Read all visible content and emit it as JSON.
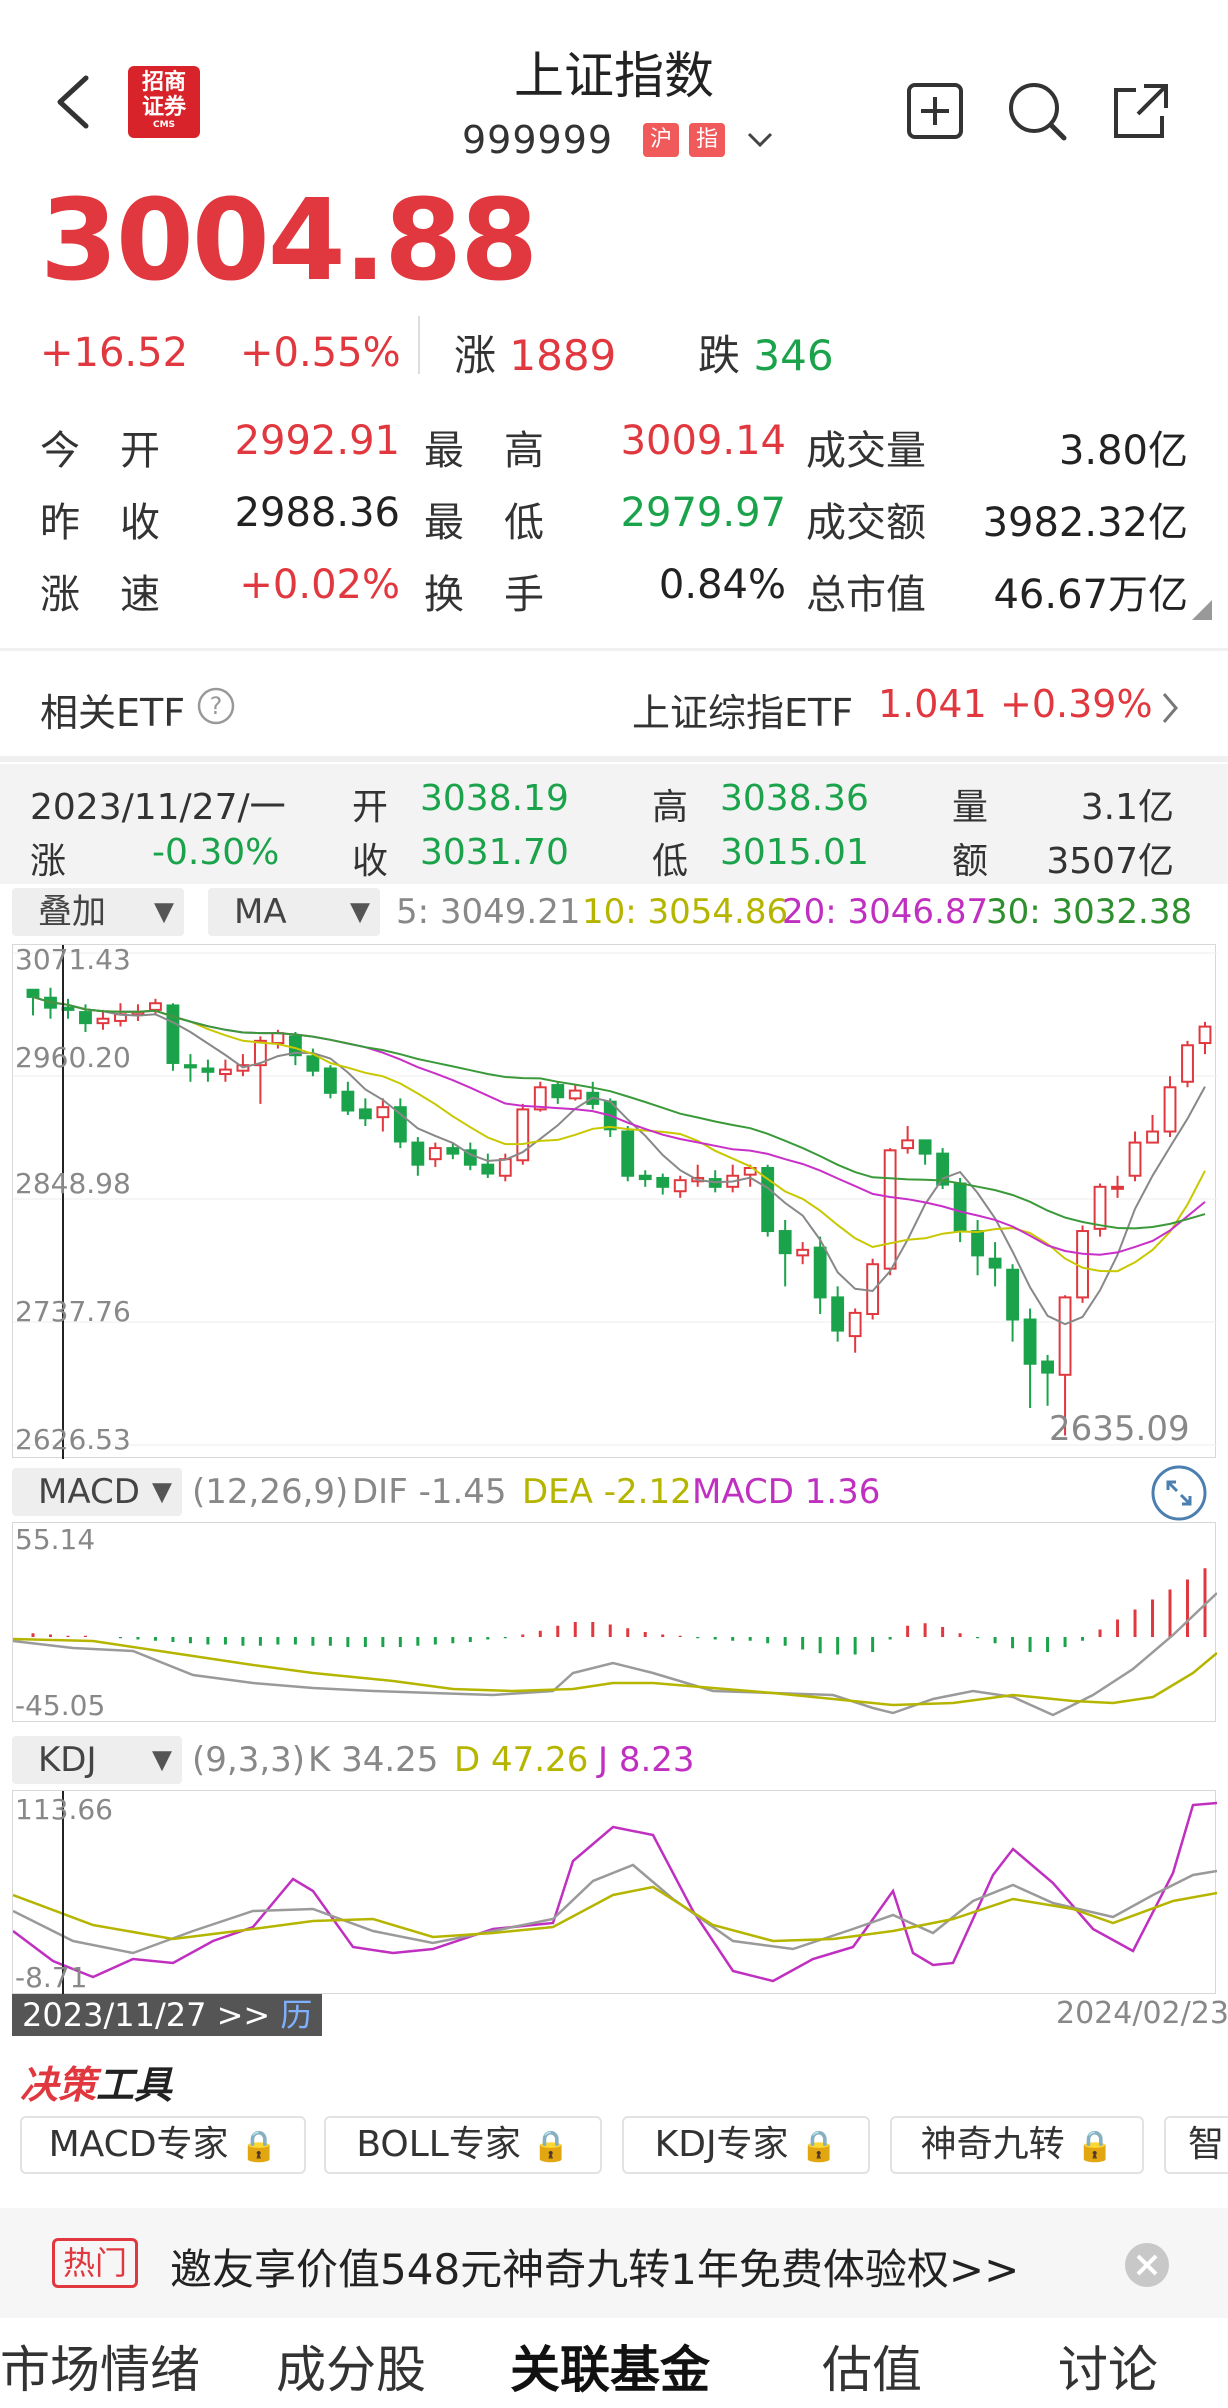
{
  "header": {
    "title": "上证指数",
    "code": "999999",
    "badges": [
      "沪",
      "指"
    ],
    "logo": {
      "line1": "招商",
      "line2": "证券",
      "line3": "CMS"
    }
  },
  "price": {
    "last": "3004.88",
    "change": "+16.52",
    "change_pct": "+0.55%",
    "up_label": "涨",
    "up_count": "1889",
    "down_label": "跌",
    "down_count": "346"
  },
  "stats": [
    {
      "label": "今　开",
      "value": "2992.91",
      "color": "red"
    },
    {
      "label": "最　高",
      "value": "3009.14",
      "color": "red"
    },
    {
      "label": "成交量",
      "value": "3.80亿",
      "color": "dark"
    },
    {
      "label": "昨　收",
      "value": "2988.36",
      "color": "dark"
    },
    {
      "label": "最　低",
      "value": "2979.97",
      "color": "green"
    },
    {
      "label": "成交额",
      "value": "3982.32亿",
      "color": "dark"
    },
    {
      "label": "涨　速",
      "value": "+0.02%",
      "color": "red"
    },
    {
      "label": "换　手",
      "value": "0.84%",
      "color": "dark"
    },
    {
      "label": "总市值",
      "value": "46.67万亿",
      "color": "dark"
    }
  ],
  "etf": {
    "label": "相关ETF",
    "name": "上证综指ETF",
    "price": "1.041",
    "pct": "+0.39%"
  },
  "kline_info": {
    "date": "2023/11/27/一",
    "open_label": "开",
    "open": "3038.19",
    "high_label": "高",
    "high": "3038.36",
    "vol_label": "量",
    "vol": "3.1亿",
    "chg_label": "涨",
    "chg": "-0.30%",
    "close_label": "收",
    "close": "3031.70",
    "low_label": "低",
    "low": "3015.01",
    "amt_label": "额",
    "amt": "3507亿"
  },
  "ma_bar": {
    "overlay": "叠加",
    "ma": "MA",
    "ma5": "5: 3049.21",
    "ma10": "10: 3054.86",
    "ma20": "20: 3046.87",
    "ma30": "30: 3032.38"
  },
  "main_axis": [
    "3071.43",
    "2960.20",
    "2848.98",
    "2737.76",
    "2626.53"
  ],
  "low_marker": "2635.09",
  "macd_bar": {
    "name": "MACD",
    "params": "(12,26,9)",
    "dif": "DIF -1.45",
    "dea": "DEA -2.12",
    "macd": "MACD 1.36",
    "axis_top": "55.14",
    "axis_bottom": "-45.05"
  },
  "kdj_bar": {
    "name": "KDJ",
    "params": "(9,3,3)",
    "k": "K 34.25",
    "d": "D 47.26",
    "j": "J 8.23",
    "axis_top": "113.66",
    "axis_bottom": "-8.71"
  },
  "date_bar": {
    "start": "2023/11/27 >>",
    "start_link": "历",
    "end": "2024/02/23"
  },
  "tools": {
    "title_a": "决策",
    "title_b": "工具",
    "buttons": [
      "MACD专家",
      "BOLL专家",
      "KDJ专家",
      "神奇九转",
      "智"
    ]
  },
  "promo": {
    "tag": "热门",
    "text": "邀友享价值548元神奇九转1年免费体验权>>"
  },
  "bottom_tabs": [
    "市场情绪",
    "成分股",
    "关联基金",
    "估值",
    "讨论"
  ],
  "active_tab": 2,
  "colors": {
    "up": "#e0383e",
    "down": "#1aa34a",
    "ma5": "#888888",
    "ma10": "#c8c800",
    "ma20": "#c830c8",
    "ma30": "#3a9a3a"
  },
  "chart_data": {
    "type": "candlestick",
    "x_start": "2023/11/27",
    "x_end": "2024/02/23",
    "ylim": [
      2626.53,
      3071.43
    ],
    "candles": [
      [
        3038.19,
        3031.7,
        3038.36,
        3015.01
      ],
      [
        3031,
        3022,
        3040,
        3012
      ],
      [
        3022,
        3020,
        3030,
        3012
      ],
      [
        3018,
        3008,
        3025,
        3000
      ],
      [
        3008,
        3012,
        3020,
        3002
      ],
      [
        3010,
        3016,
        3026,
        3005
      ],
      [
        3016,
        3018,
        3025,
        3010
      ],
      [
        3020,
        3026,
        3030,
        3015
      ],
      [
        3024,
        2972,
        3026,
        2965
      ],
      [
        2970,
        2968,
        2980,
        2955
      ],
      [
        2967,
        2964,
        2975,
        2955
      ],
      [
        2962,
        2966,
        2975,
        2955
      ],
      [
        2965,
        2970,
        2980,
        2960
      ],
      [
        2970,
        2992,
        2996,
        2935
      ],
      [
        2990,
        2999,
        3002,
        2985
      ],
      [
        2996,
        2979,
        3000,
        2970
      ],
      [
        2978,
        2965,
        2985,
        2960
      ],
      [
        2967,
        2945,
        2970,
        2940
      ],
      [
        2946,
        2929,
        2955,
        2925
      ],
      [
        2930,
        2922,
        2940,
        2915
      ],
      [
        2923,
        2932,
        2940,
        2910
      ],
      [
        2932,
        2901,
        2940,
        2895
      ],
      [
        2900,
        2880,
        2905,
        2870
      ],
      [
        2885,
        2895,
        2900,
        2878
      ],
      [
        2895,
        2890,
        2900,
        2885
      ],
      [
        2893,
        2880,
        2900,
        2875
      ],
      [
        2880,
        2872,
        2890,
        2868
      ],
      [
        2870,
        2885,
        2890,
        2865
      ],
      [
        2884,
        2930,
        2935,
        2880
      ],
      [
        2930,
        2950,
        2955,
        2928
      ],
      [
        2952,
        2941,
        2955,
        2935
      ],
      [
        2940,
        2947,
        2952,
        2938
      ],
      [
        2945,
        2935,
        2955,
        2930
      ],
      [
        2937,
        2912,
        2940,
        2905
      ],
      [
        2910,
        2870,
        2915,
        2865
      ],
      [
        2870,
        2867,
        2875,
        2860
      ],
      [
        2868,
        2860,
        2872,
        2853
      ],
      [
        2856,
        2866,
        2870,
        2850
      ],
      [
        2865,
        2868,
        2880,
        2860
      ],
      [
        2867,
        2860,
        2875,
        2855
      ],
      [
        2860,
        2870,
        2880,
        2855
      ],
      [
        2871,
        2877,
        2880,
        2860
      ],
      [
        2877,
        2820,
        2880,
        2815
      ],
      [
        2820,
        2800,
        2830,
        2770
      ],
      [
        2798,
        2803,
        2810,
        2790
      ],
      [
        2805,
        2760,
        2815,
        2745
      ],
      [
        2760,
        2730,
        2770,
        2720
      ],
      [
        2725,
        2746,
        2750,
        2710
      ],
      [
        2745,
        2790,
        2795,
        2740
      ],
      [
        2786,
        2893,
        2895,
        2780
      ],
      [
        2895,
        2902,
        2915,
        2890
      ],
      [
        2902,
        2890,
        2900,
        2880
      ],
      [
        2890,
        2862,
        2895,
        2858
      ],
      [
        2863,
        2820,
        2868,
        2810
      ],
      [
        2820,
        2798,
        2830,
        2780
      ],
      [
        2795,
        2787,
        2810,
        2770
      ],
      [
        2785,
        2740,
        2790,
        2720
      ],
      [
        2740,
        2700,
        2750,
        2660
      ],
      [
        2702,
        2692,
        2708,
        2662
      ],
      [
        2690,
        2760,
        2762,
        2635.09
      ],
      [
        2760,
        2820,
        2825,
        2755
      ],
      [
        2822,
        2860,
        2863,
        2815
      ],
      [
        2860,
        2860,
        2870,
        2850
      ],
      [
        2870,
        2900,
        2910,
        2865
      ],
      [
        2900,
        2910,
        2925,
        2900
      ],
      [
        2910,
        2950,
        2960,
        2905
      ],
      [
        2955,
        2988,
        2992,
        2950
      ],
      [
        2990,
        3004.88,
        3009.14,
        2979.97
      ]
    ],
    "macd_hist": [
      3,
      2,
      1,
      1,
      0,
      -1,
      -2,
      -3,
      -4,
      -5,
      -6,
      -6,
      -7,
      -7,
      -6,
      -6,
      -7,
      -7,
      -8,
      -8,
      -8,
      -8,
      -7,
      -6,
      -5,
      -4,
      -2,
      -1,
      2,
      5,
      9,
      12,
      12,
      10,
      7,
      4,
      2,
      1,
      -1,
      -2,
      -3,
      -3,
      -5,
      -7,
      -10,
      -13,
      -14,
      -14,
      -12,
      -2,
      9,
      11,
      8,
      3,
      -1,
      -5,
      -9,
      -12,
      -12,
      -8,
      -3,
      6,
      14,
      22,
      30,
      38,
      46,
      55
    ]
  }
}
